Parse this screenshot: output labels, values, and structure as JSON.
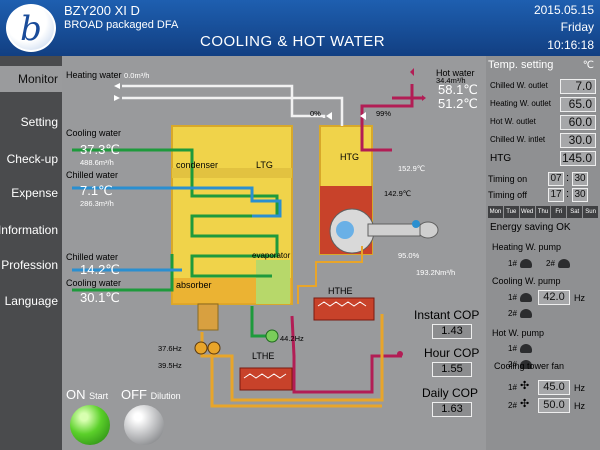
{
  "header": {
    "model": "BZY200 XI D",
    "subtitle": "BROAD packaged DFA",
    "title": "COOLING & HOT WATER",
    "date": "2015.05.15",
    "day": "Friday",
    "time": "10:16:18",
    "logo_glyph": "b"
  },
  "nav": {
    "items": [
      "Monitor",
      "Setting",
      "Check-up",
      "Expense",
      "Information",
      "Profession",
      "Language"
    ]
  },
  "controls": {
    "on": "ON",
    "on_sub": "Start",
    "off": "OFF",
    "off_sub": "Dilution"
  },
  "diagram": {
    "heating_water": {
      "label": "Heating water",
      "flow": "0.0m³/h"
    },
    "hot_water": {
      "label": "Hot water",
      "flow": "34.4m³/h",
      "out_temp": "58.1℃",
      "in_temp": "51.2℃"
    },
    "cooling_water_top": {
      "label": "Cooling water",
      "temp": "37.3℃",
      "flow": "488.6m³/h"
    },
    "chilled_water_top": {
      "label": "Chilled water",
      "temp": "7.1℃",
      "flow": "286.3m³/h"
    },
    "chilled_water_bottom": {
      "label": "Chilled water",
      "temp": "14.2℃"
    },
    "cooling_water_bottom": {
      "label": "Cooling water",
      "temp": "30.1℃"
    },
    "valve_left": "0%",
    "valve_right": "99%",
    "htg_label": "HTG",
    "htg_temp": "152.9℃",
    "htg_lower_temp": "142.9℃",
    "burner_pct": "95.0%",
    "gas_flow": "193.2Nm³/h",
    "condenser": "condenser",
    "ltg": "LTG",
    "evaporator": "evaporator",
    "absorber": "absorber",
    "hthe": "HTHE",
    "lthe": "LTHE",
    "pump_hz": "44.2Hz",
    "pump1_hz": "37.6Hz",
    "pump2_hz": "39.5Hz"
  },
  "cop": {
    "instant_label": "Instant COP",
    "instant": "1.43",
    "hour_label": "Hour COP",
    "hour": "1.55",
    "daily_label": "Daily COP",
    "daily": "1.63"
  },
  "settings": {
    "header": "Temp. setting",
    "unit": "℃",
    "rows": [
      {
        "label": "Chilled W. outlet",
        "value": "7.0"
      },
      {
        "label": "Heating W. outlet",
        "value": "65.0"
      },
      {
        "label": "Hot W. outlet",
        "value": "60.0"
      },
      {
        "label": "Chilled W. intlet",
        "value": "30.0"
      },
      {
        "label": "HTG",
        "value": "145.0"
      }
    ],
    "timing_on": {
      "label": "Timing on",
      "h": "07",
      "m": "30"
    },
    "timing_off": {
      "label": "Timing off",
      "h": "17",
      "m": "30"
    },
    "days": [
      "Mon",
      "Tue",
      "Wed",
      "Thu",
      "Fri",
      "Sat",
      "Sun"
    ],
    "energy": "Energy saving   OK",
    "heating_pump": {
      "label": "Heating W. pump",
      "p1": "1#",
      "p2": "2#"
    },
    "cooling_pump": {
      "label": "Cooling W. pump",
      "p1": "1#",
      "p2": "2#",
      "hz": "42.0",
      "unit": "Hz"
    },
    "hot_pump": {
      "label": "Hot W. pump",
      "p1": "1#",
      "p2": "2#"
    },
    "fan": {
      "label": "Cooling tower fan",
      "p1": "1#",
      "p2": "2#",
      "hz1": "45.0",
      "hz2": "50.0",
      "unit": "Hz"
    }
  },
  "colors": {
    "cooling_pipe": "#1e9a3c",
    "chilled_pipe": "#2a8fd0",
    "hot_pipe": "#b21d55",
    "solution_pipe": "#e8a52a",
    "vessel": "#f0d34a",
    "header_blue": "#1e5fb0"
  }
}
